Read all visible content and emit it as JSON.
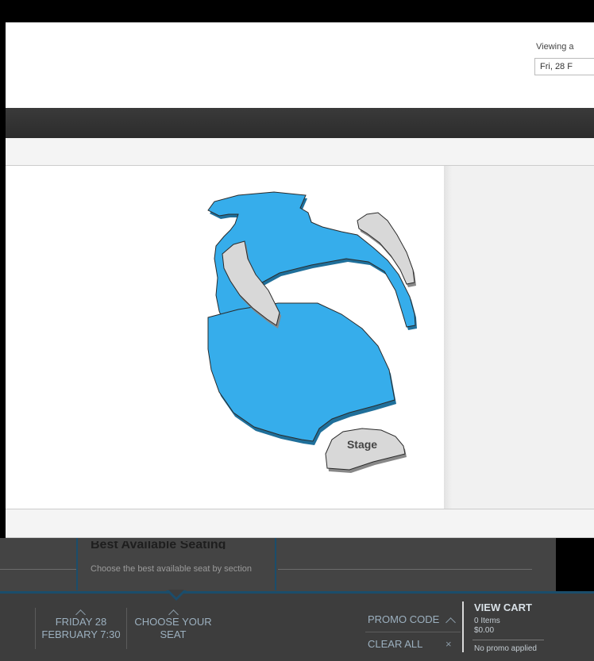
{
  "header": {
    "viewing_label": "Viewing a",
    "date_select_value": "Fri, 28 F"
  },
  "map": {
    "stage_label": "Stage",
    "colors": {
      "available_section": "#36adeb",
      "unavailable_section": "#d8d8d8",
      "outline": "#2a2a2a"
    }
  },
  "best_available": {
    "title": "Best Available Seating",
    "subtitle": "Choose the best available seat by section"
  },
  "footer": {
    "step1": {
      "line1": "FRIDAY 28",
      "line2": "FEBRUARY 7:30"
    },
    "step2": {
      "line1": "CHOOSE YOUR",
      "line2": "SEAT"
    },
    "promo_code": "PROMO CODE",
    "clear_all": "CLEAR ALL",
    "clear_icon": "×",
    "cart": {
      "title": "VIEW CART",
      "items": "0 Items",
      "total": "$0.00",
      "promo_status": "No promo applied"
    },
    "colors": {
      "accent": "#1b4d6b",
      "background": "#3d3d3d"
    }
  }
}
